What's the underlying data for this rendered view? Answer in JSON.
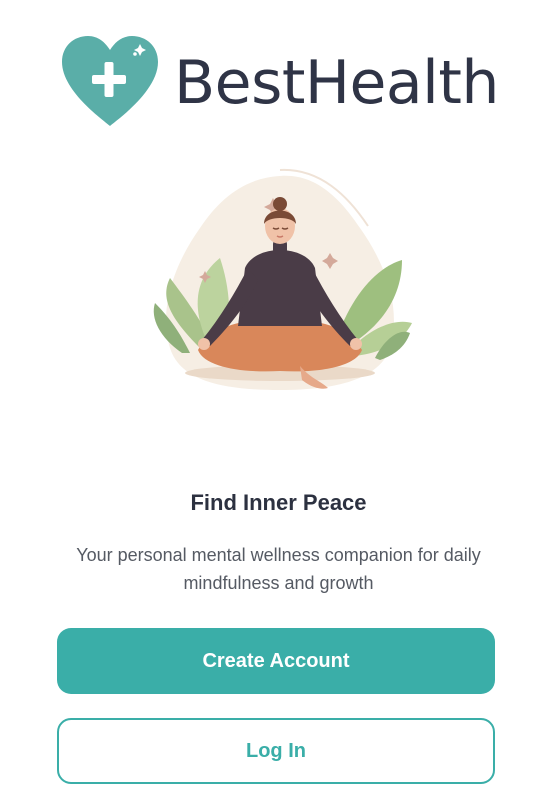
{
  "app": {
    "brand_name": "BestHealth",
    "logo_icon": "heart-plus-icon",
    "brand_color": "#3aaea8"
  },
  "hero": {
    "illustration": "meditating-woman-illustration",
    "title": "Find Inner Peace",
    "subtitle": "Your personal mental wellness companion for daily mindfulness and growth"
  },
  "actions": {
    "create_account_label": "Create Account",
    "login_label": "Log In"
  }
}
